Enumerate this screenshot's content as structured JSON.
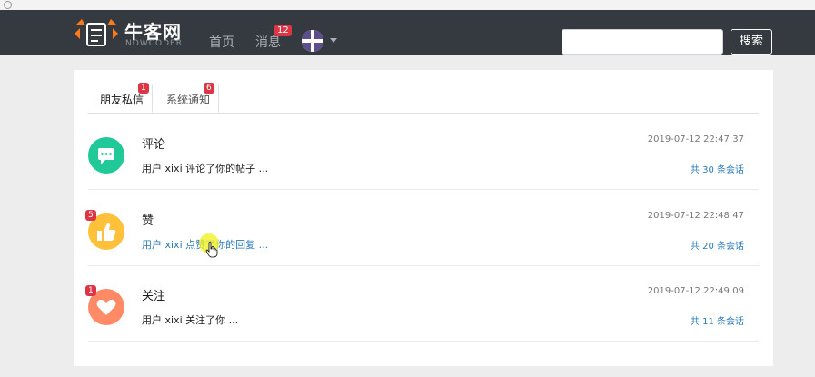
{
  "navbar": {
    "logo_cn": "牛客网",
    "logo_en": "NOWCODER",
    "links": [
      {
        "label": "首页"
      },
      {
        "label": "消息",
        "badge": "12"
      }
    ],
    "search": {
      "value": "",
      "button_label": "搜索"
    }
  },
  "tabs": [
    {
      "label": "朋友私信",
      "badge": "1",
      "active": true
    },
    {
      "label": "系统通知",
      "badge": "6",
      "active": false
    }
  ],
  "notices": [
    {
      "title": "评论",
      "summary": "用户 xixi 评论了你的帖子 ...",
      "time": "2019-07-12 22:47:37",
      "count": "共 30 条会话",
      "badge": "",
      "icon": "comment-icon",
      "color": "#20c997"
    },
    {
      "title": "赞",
      "summary": "用户 xixi 点赞了你的回复 ...",
      "time": "2019-07-12 22:48:47",
      "count": "共 20 条会话",
      "badge": "5",
      "icon": "thumbs-up-icon",
      "color": "#ffc13a"
    },
    {
      "title": "关注",
      "summary": "用户 xixi 关注了你 ...",
      "time": "2019-07-12 22:49:09",
      "count": "共 11 条会话",
      "badge": "1",
      "icon": "heart-icon",
      "color": "#ff8a65"
    }
  ],
  "colors": {
    "navbar": "#343a40",
    "badge": "#dc3545",
    "link": "#2a7ab8"
  }
}
